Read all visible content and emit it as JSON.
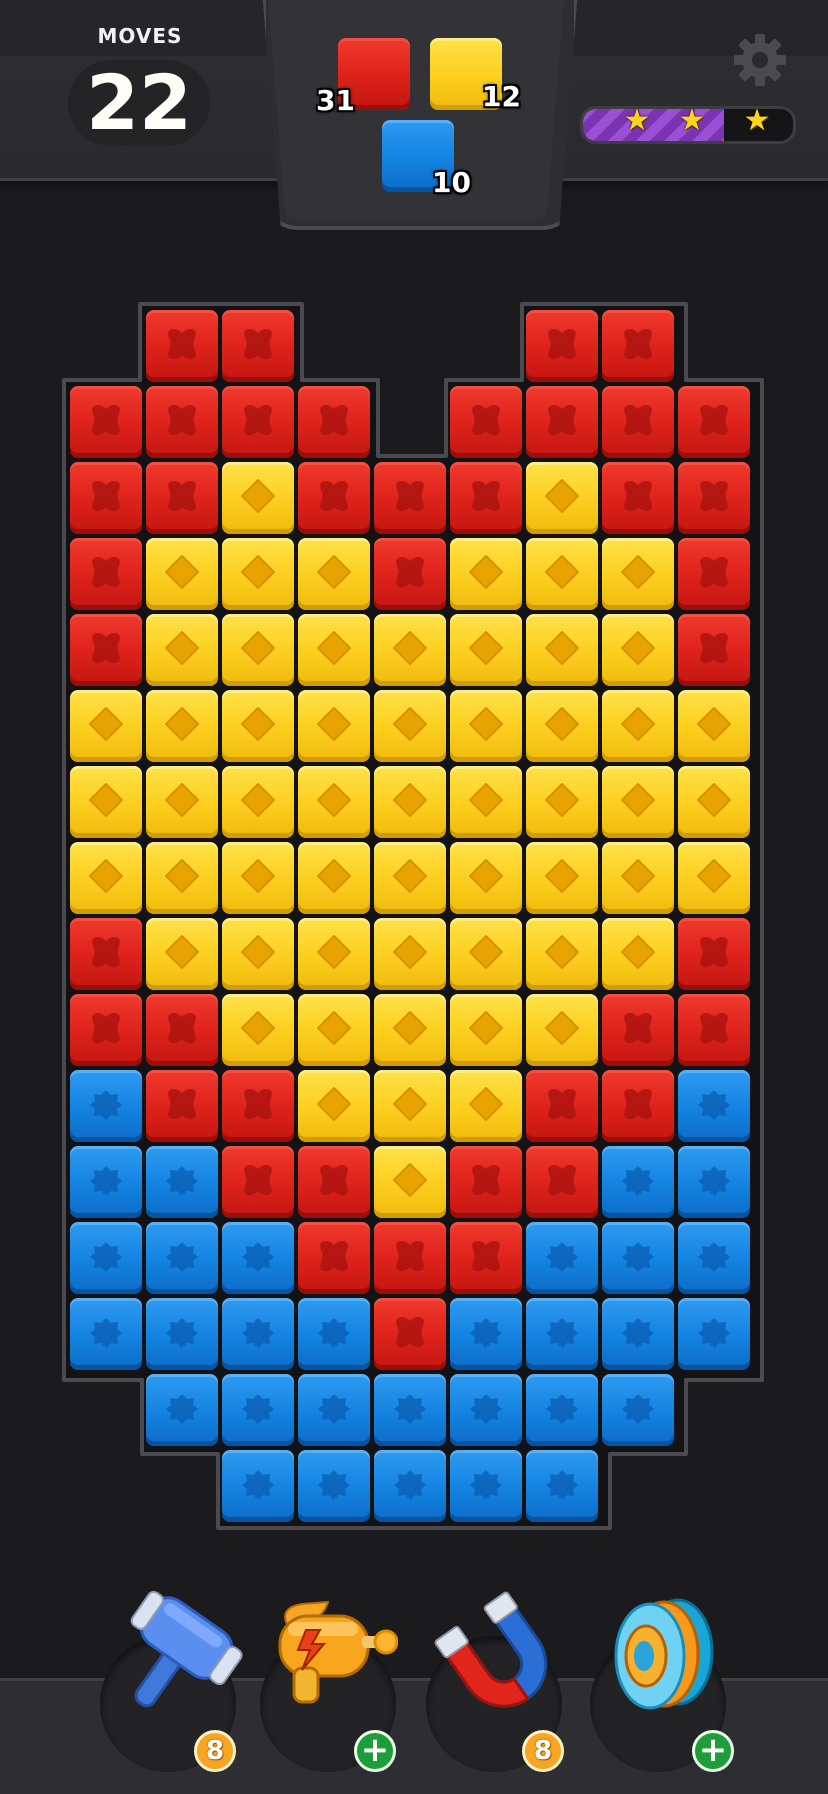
{
  "hud": {
    "moves_label": "MOVES",
    "moves_value": "22",
    "goals": [
      {
        "color": "red",
        "count": "31"
      },
      {
        "color": "yellow",
        "count": "12"
      },
      {
        "color": "blue",
        "count": "10"
      }
    ],
    "stars_total": 3,
    "stars_earned": 2,
    "star_progress": 0.67
  },
  "board": {
    "rows": [
      "-RR---RR-",
      "RRRR-RRRR",
      "RRYRRRYRR",
      "RYYYRYYYR",
      "RYYYYYYYR",
      "YYYYYYYYY",
      "YYYYYYYYY",
      "YYYYYYYYY",
      "RYYYYYYYR",
      "RRYYYYYRR",
      "BRRYYYRRB",
      "BBRRYRRBB",
      "BBBRRRBBB",
      "BBBBRBBBB",
      "-BBBBBBB-",
      "--BBBBB--"
    ],
    "legend": {
      "R": "red",
      "Y": "yellow",
      "B": "blue",
      "-": "empty"
    }
  },
  "boosters": [
    {
      "name": "hammer",
      "icon": "hammer-icon",
      "badge_type": "count",
      "badge": "8"
    },
    {
      "name": "laser-gun",
      "icon": "laser-gun-icon",
      "badge_type": "plus",
      "badge": "+"
    },
    {
      "name": "magnet",
      "icon": "magnet-icon",
      "badge_type": "count",
      "badge": "8"
    },
    {
      "name": "spinner",
      "icon": "spinner-icon",
      "badge_type": "plus",
      "badge": "+"
    }
  ],
  "colors": {
    "red": "#e1251d",
    "yellow": "#fcd021",
    "blue": "#1585e3",
    "star": "#ffd21f",
    "progress": "#9b4fd4",
    "badge_count": "#f6a623",
    "badge_plus": "#1f9d3a"
  }
}
